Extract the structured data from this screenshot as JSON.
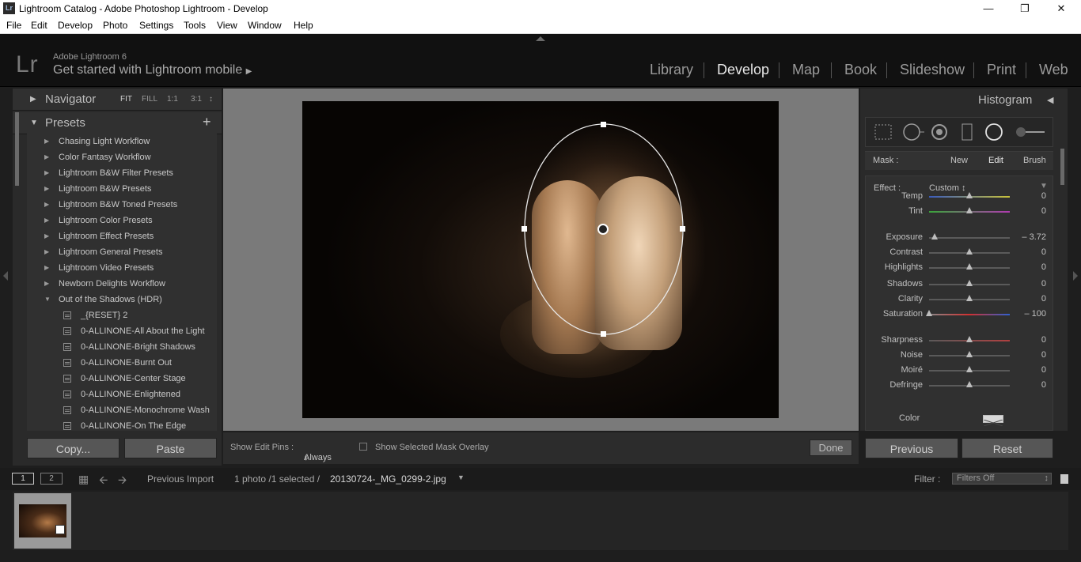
{
  "window": {
    "title": "Lightroom Catalog - Adobe Photoshop Lightroom - Develop",
    "app_icon": "Lr"
  },
  "menu": [
    "File",
    "Edit",
    "Develop",
    "Photo",
    "Settings",
    "Tools",
    "View",
    "Window",
    "Help"
  ],
  "header": {
    "logo": "Lr",
    "version": "Adobe Lightroom 6",
    "mobile_prompt": "Get started with Lightroom mobile",
    "modules": [
      "Library",
      "Develop",
      "Map",
      "Book",
      "Slideshow",
      "Print",
      "Web"
    ],
    "active_module": "Develop"
  },
  "left": {
    "navigator": {
      "title": "Navigator",
      "options": [
        "FIT",
        "FILL",
        "1:1",
        "3:1"
      ]
    },
    "presets": {
      "title": "Presets",
      "add": "+",
      "folders": [
        "Chasing Light Workflow",
        "Color Fantasy Workflow",
        "Lightroom B&W Filter Presets",
        "Lightroom B&W Presets",
        "Lightroom B&W Toned Presets",
        "Lightroom Color Presets",
        "Lightroom Effect Presets",
        "Lightroom General Presets",
        "Lightroom Video Presets",
        "Newborn Delights Workflow",
        "Out of the Shadows (HDR)"
      ],
      "items": [
        "_{RESET} 2",
        "0-ALLINONE-All About the Light",
        "0-ALLINONE-Bright Shadows",
        "0-ALLINONE-Burnt Out",
        "0-ALLINONE-Center Stage",
        "0-ALLINONE-Enlightened",
        "0-ALLINONE-Monochrome Wash",
        "0-ALLINONE-On The Edge"
      ]
    },
    "copy_button": "Copy...",
    "paste_button": "Paste"
  },
  "right": {
    "histogram_title": "Histogram",
    "mask": {
      "label": "Mask :",
      "new": "New",
      "edit": "Edit",
      "brush": "Brush"
    },
    "effect": {
      "label": "Effect :",
      "value": "Custom"
    },
    "sliders": [
      {
        "label": "Temp",
        "value": "0",
        "pos": 0.5
      },
      {
        "label": "Tint",
        "value": "0",
        "pos": 0.5
      },
      {
        "label": "Exposure",
        "value": "– 3.72",
        "pos": 0.07
      },
      {
        "label": "Contrast",
        "value": "0",
        "pos": 0.5
      },
      {
        "label": "Highlights",
        "value": "0",
        "pos": 0.5
      },
      {
        "label": "Shadows",
        "value": "0",
        "pos": 0.5
      },
      {
        "label": "Clarity",
        "value": "0",
        "pos": 0.5
      },
      {
        "label": "Saturation",
        "value": "– 100",
        "pos": 0.0
      },
      {
        "label": "Sharpness",
        "value": "0",
        "pos": 0.5
      },
      {
        "label": "Noise",
        "value": "0",
        "pos": 0.5
      },
      {
        "label": "Moiré",
        "value": "0",
        "pos": 0.5
      },
      {
        "label": "Defringe",
        "value": "0",
        "pos": 0.5
      }
    ],
    "color_label": "Color",
    "previous_button": "Previous",
    "reset_button": "Reset"
  },
  "toolbar": {
    "show_edit_pins_label": "Show Edit Pins :",
    "show_edit_pins_value": "Always",
    "mask_overlay_label": "Show Selected Mask Overlay",
    "done_button": "Done"
  },
  "filmstrip": {
    "page1": "1",
    "page2": "2",
    "source": "Previous Import",
    "selection": "1 photo /1 selected /",
    "filename": "20130724-_MG_0299-2.jpg",
    "filter_label": "Filter :",
    "filter_value": "Filters Off"
  }
}
